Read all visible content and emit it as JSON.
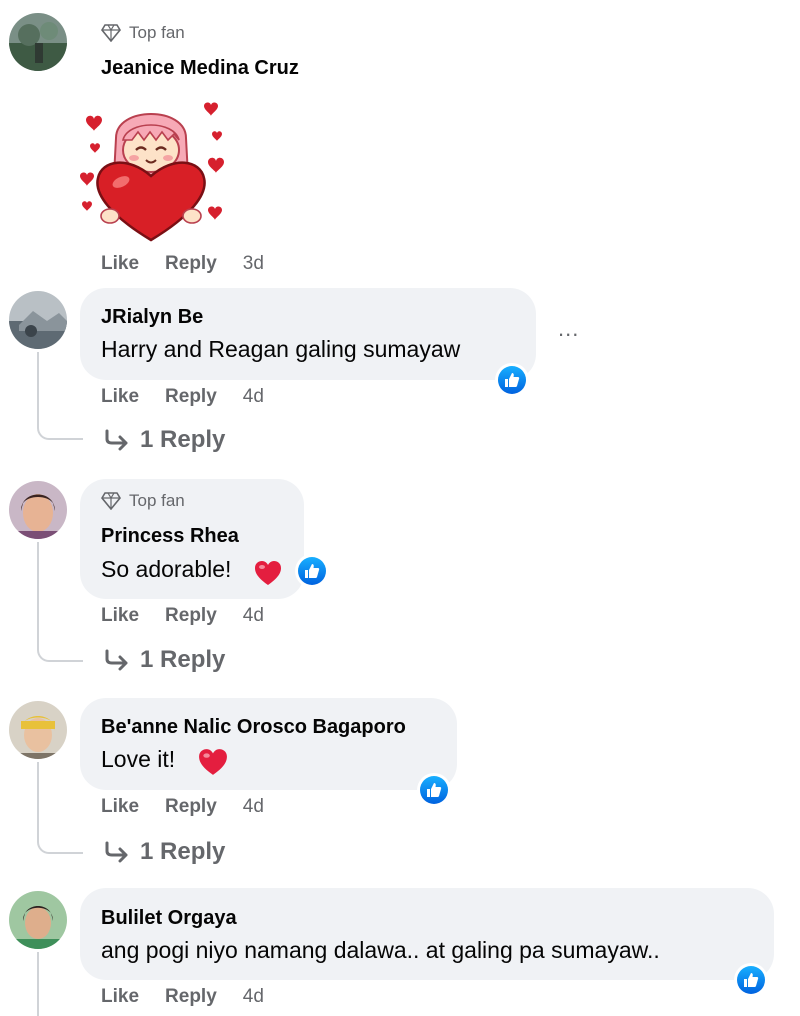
{
  "actions": {
    "like": "Like",
    "reply": "Reply"
  },
  "comments": [
    {
      "author": "Jeanice Medina Cruz",
      "badge": "Top fan",
      "text": "",
      "sticker": "girl-holding-heart-sticker",
      "time": "3d",
      "replies": "",
      "has_reaction": false
    },
    {
      "author": "JRialyn Be",
      "badge": "",
      "text": "Harry and Reagan galing sumayaw",
      "time": "4d",
      "replies": "1 Reply",
      "has_reaction": true,
      "more": "..."
    },
    {
      "author": "Princess Rhea",
      "badge": "Top fan",
      "text": "So adorable!",
      "emoji": "heart-emoji",
      "time": "4d",
      "replies": "1 Reply",
      "has_reaction": true
    },
    {
      "author": "Be'anne Nalic Orosco Bagaporo",
      "badge": "",
      "text": "Love it!",
      "emoji": "heart-emoji",
      "time": "4d",
      "replies": "1 Reply",
      "has_reaction": true
    },
    {
      "author": "Bulilet Orgaya",
      "badge": "",
      "text": "ang pogi niyo namang dalawa.. at galing pa sumayaw..",
      "time": "4d",
      "replies": "",
      "has_reaction": true
    }
  ],
  "colors": {
    "bubble": "#f0f2f5",
    "meta_text": "#65676b",
    "reaction_blue": "#1877f2",
    "heart_red": "#e41e3f"
  }
}
